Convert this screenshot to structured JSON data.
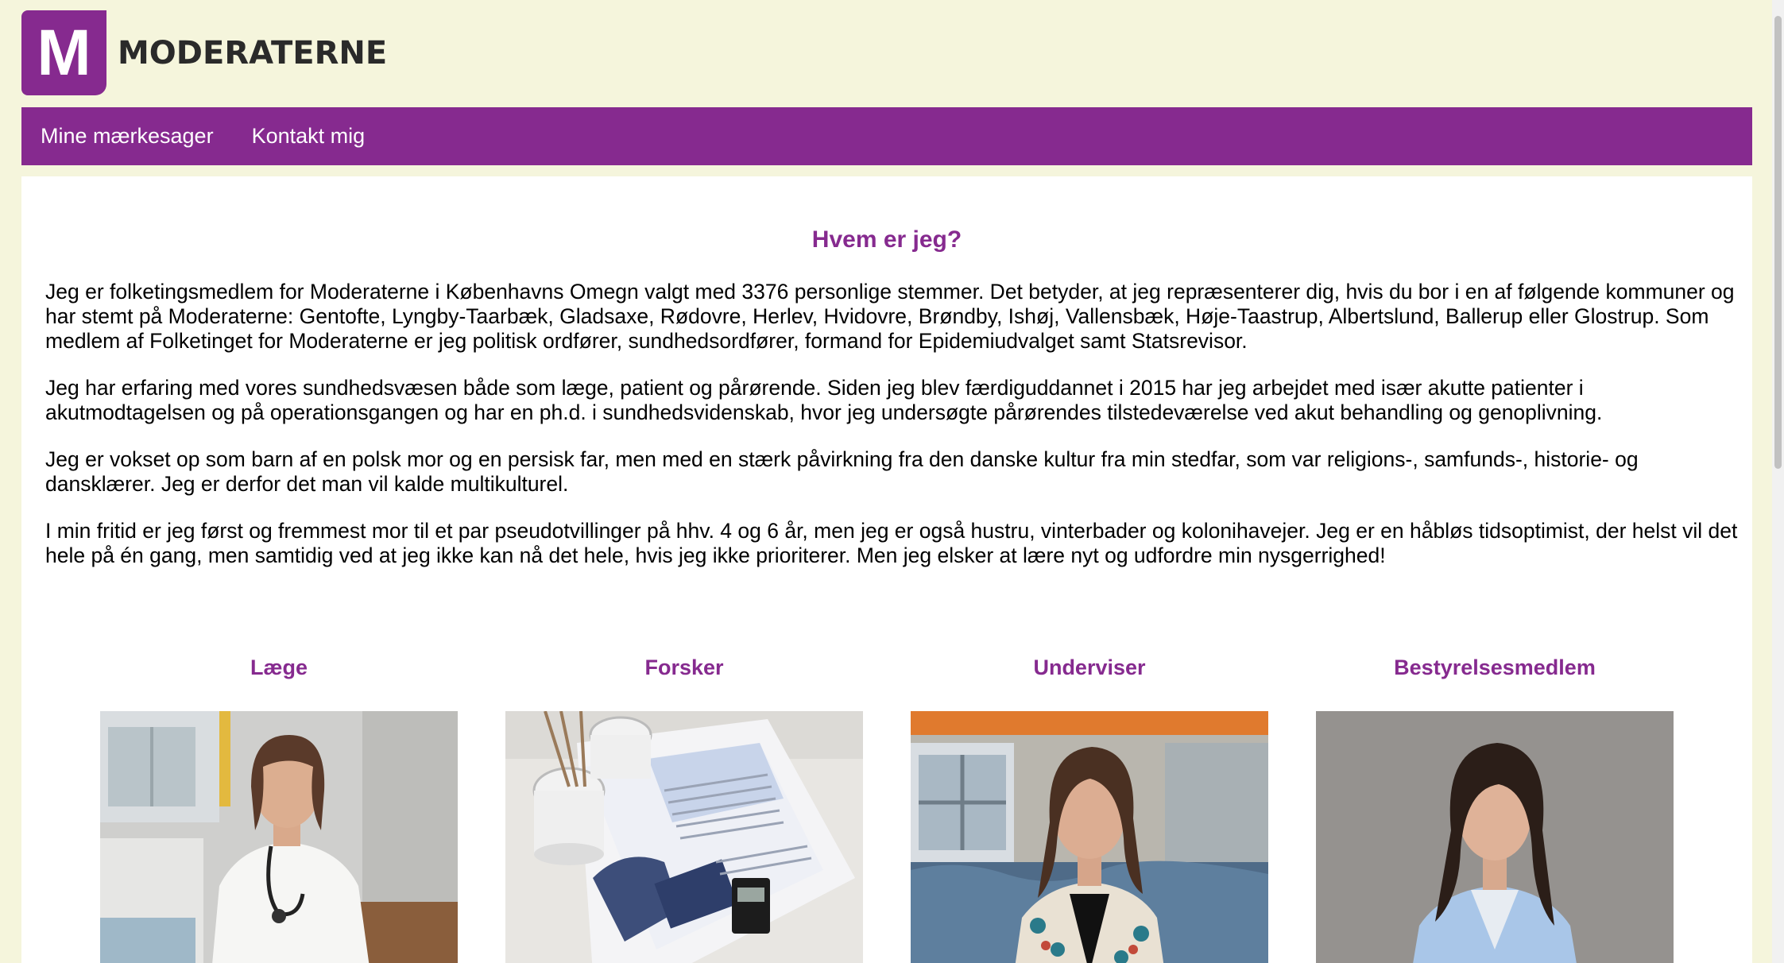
{
  "brand": {
    "logo_letter": "M",
    "name": "MODERATERNE",
    "color": "#862a8f"
  },
  "nav": {
    "items": [
      {
        "label": "Mine mærkesager"
      },
      {
        "label": "Kontakt mig"
      }
    ]
  },
  "main": {
    "heading": "Hvem er jeg?",
    "paragraphs": [
      "Jeg er folketingsmedlem for Moderaterne i Københavns Omegn valgt med 3376 personlige stemmer. Det betyder, at jeg repræsenterer dig, hvis du bor i en af følgende kommuner og har stemt på Moderaterne: Gentofte, Lyngby-Taarbæk, Gladsaxe, Rødovre, Herlev, Hvidovre, Brøndby, Ishøj, Vallensbæk, Høje-Taastrup, Albertslund, Ballerup eller Glostrup. Som medlem af Folketinget for Moderaterne er jeg politisk ordfører, sundhedsordfører, formand for Epidemiudvalget samt Statsrevisor.",
      "Jeg har erfaring med vores sundhedsvæsen både som læge, patient og pårørende. Siden jeg blev færdiguddannet i 2015 har jeg arbejdet med især akutte patienter i akutmodtagelsen og på operationsgangen og har en ph.d. i sundhedsvidenskab, hvor jeg undersøgte pårørendes tilstedeværelse ved akut behandling og genoplivning.",
      "Jeg er vokset op som barn af en polsk mor og en persisk far, men med en stærk påvirkning fra den danske kultur fra min stedfar, som var religions-, samfunds-, historie- og dansklærer. Jeg er derfor det man vil kalde multikulturel.",
      "I min fritid er jeg først og fremmest mor til et par pseudotvillinger på hhv. 4 og 6 år, men jeg er også hustru, vinterbader og kolonihavejer. Jeg er en håbløs tidsoptimist, der helst vil det hele på én gang, men samtidig ved at jeg ikke kan nå det hele, hvis jeg ikke prioriterer. Men jeg elsker at lære nyt og udfordre min nysgerrighed!"
    ]
  },
  "cards": [
    {
      "title": "Læge"
    },
    {
      "title": "Forsker"
    },
    {
      "title": "Underviser"
    },
    {
      "title": "Bestyrelsesmedlem"
    }
  ]
}
